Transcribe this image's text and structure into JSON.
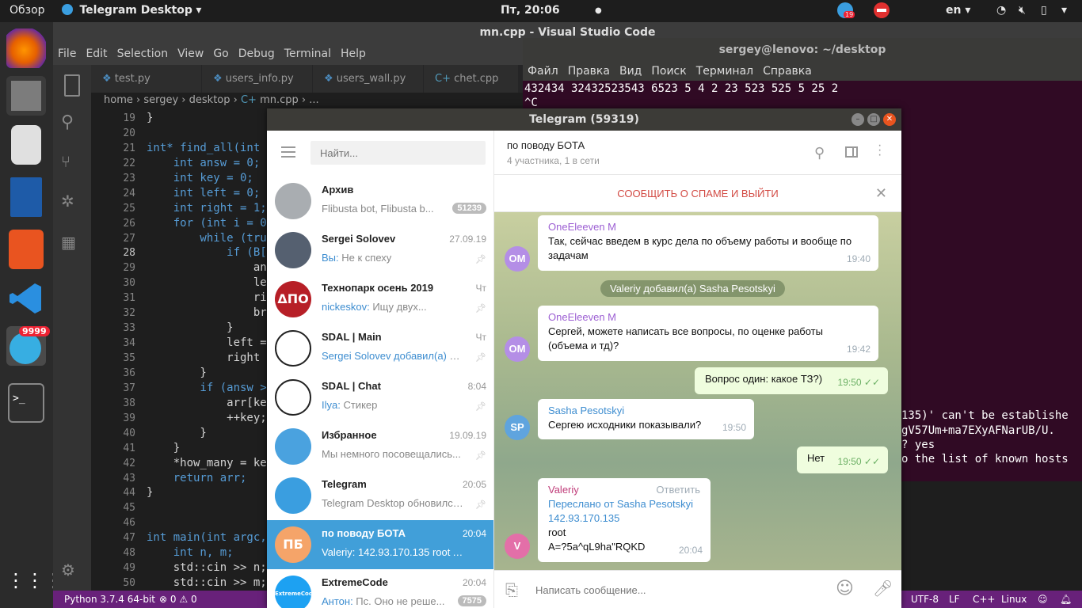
{
  "topbar": {
    "overview": "Обзор",
    "app_name": "Telegram Desktop",
    "clock": "Пт, 20:06",
    "lang": "en",
    "tray_badge": "19"
  },
  "dock": {
    "telegram_badge": "9999"
  },
  "vscode": {
    "title": "mn.cpp - Visual Studio Code",
    "menu": [
      "File",
      "Edit",
      "Selection",
      "View",
      "Go",
      "Debug",
      "Terminal",
      "Help"
    ],
    "tabs": [
      "test.py",
      "users_info.py",
      "users_wall.py",
      "chet.cpp"
    ],
    "breadcrumb": [
      "home",
      "sergey",
      "desktop",
      "mn.cpp",
      "..."
    ],
    "gutter": [
      "19",
      "20",
      "21",
      "22",
      "23",
      "24",
      "25",
      "26",
      "27",
      "28",
      "29",
      "30",
      "31",
      "32",
      "33",
      "34",
      "35",
      "36",
      "37",
      "38",
      "39",
      "40",
      "41",
      "42",
      "43",
      "44",
      "45",
      "46",
      "47",
      "48",
      "49",
      "50"
    ],
    "code": [
      "}",
      "",
      "int* find_all(int",
      "    int answ = 0;",
      "    int key = 0;",
      "    int left = 0;",
      "    int right = 1;",
      "    for (int i = 0",
      "        while (tru",
      "            if (B[",
      "                an",
      "                le",
      "                ri",
      "                br",
      "            }",
      "            left =",
      "            right",
      "        }",
      "        if (answ >",
      "            arr[ke",
      "            ++key;",
      "        }",
      "    }",
      "    *how_many = ke",
      "    return arr;",
      "}",
      "",
      "",
      "int main(int argc,",
      "    int n, m;",
      "    std::cin >> n;",
      "    std::cin >> m;"
    ],
    "status": {
      "python": "Python 3.7.4 64-bit",
      "errors": "0",
      "warnings": "0",
      "encoding": "UTF-8",
      "eol": "LF",
      "language": "C++",
      "os": "Linux"
    }
  },
  "terminal": {
    "title": "sergey@lenovo: ~/desktop",
    "menu": [
      "Файл",
      "Правка",
      "Вид",
      "Поиск",
      "Терминал",
      "Справка"
    ],
    "lines": [
      "432434 32432523543 6523 5 4 2 23 523 525 5 25 2",
      "^C"
    ],
    "lower_lines": [
      "135)' can't be establishe",
      "gV57Um+ma7EXyAFNarUB/U.",
      "? yes",
      "o the list of known hosts"
    ]
  },
  "telegram": {
    "title": "Telegram (59319)",
    "search_placeholder": "Найти...",
    "chats": [
      {
        "name": "Архив",
        "time": "",
        "sender": "",
        "preview": "Flibusta bot, Flibusta b...",
        "badge": "51239",
        "avatar": "",
        "color": "#a9adb1"
      },
      {
        "name": "Sergei Solovev",
        "time": "27.09.19",
        "sender": "Вы: ",
        "preview": "Не к спеху",
        "badge": "",
        "avatar": "",
        "color": "#556070"
      },
      {
        "name": "Технопарк осень 2019",
        "time": "Чт",
        "sender": "nickeskov: ",
        "preview": "Ищу двух...",
        "badge": "",
        "avatar": "ΔΠΟ",
        "color": "#b71f27"
      },
      {
        "name": "SDAL | Main",
        "time": "Чт",
        "sender": "",
        "preview": "Sergei Solovev добавил(а) S...",
        "badge": "",
        "avatar": "",
        "color": "#ffffff"
      },
      {
        "name": "SDAL | Chat",
        "time": "8:04",
        "sender": "Ilya: ",
        "preview": "Стикер",
        "badge": "",
        "avatar": "",
        "color": "#ffffff"
      },
      {
        "name": "Избранное",
        "time": "19.09.19",
        "sender": "",
        "preview": "Мы немного посовещались...",
        "badge": "",
        "avatar": "",
        "color": "#4aa2df"
      },
      {
        "name": "Telegram",
        "time": "20:05",
        "sender": "",
        "preview": "Telegram Desktop обновился д...",
        "badge": "",
        "avatar": "",
        "color": "#3a9ee0"
      },
      {
        "name": "по поводу БОТА",
        "time": "20:04",
        "sender": "",
        "preview": "Valeriy: 142.93.170.135 root A=?...",
        "badge": "",
        "avatar": "ПБ",
        "color": "#f5a469"
      },
      {
        "name": "ExtremeCode",
        "time": "20:04",
        "sender": "Антон: ",
        "preview": "Пс. Оно не реше...",
        "badge": "7575",
        "avatar": "ExtremeCode",
        "color": "#1da1f2"
      }
    ],
    "header": {
      "name": "по поводу БОТА",
      "status": "4 участника, 1 в сети"
    },
    "spam_bar": "СООБЩИТЬ О СПАМЕ И ВЫЙТИ",
    "messages": [
      {
        "sender": "OneEleeven M",
        "text1": "Так, сейчас введем в курс дела по объему работы и вообще по",
        "text2": "задачам",
        "time": "19:40",
        "avatar": "OM"
      },
      {
        "service": "Valeriy добавил(а) Sasha Pesotskyi"
      },
      {
        "sender": "OneEleeven M",
        "text1": "Сергей, можете написать все вопросы, по оценке работы",
        "text2": "(объема и тд)?",
        "time": "19:42",
        "avatar": "OM"
      },
      {
        "text1": "Вопрос один: какое ТЗ?)",
        "time": "19:50",
        "out": true
      },
      {
        "sender": "Sasha Pesotskyi",
        "text1": "Сергею исходники показывали?",
        "time": "19:50",
        "avatar": "SP"
      },
      {
        "text1": "Нет",
        "time": "19:50",
        "out": true
      },
      {
        "sender": "Valeriy",
        "reply": "Ответить",
        "fwd": "Переслано от Sasha Pesotskyi",
        "link": "142.93.170.135",
        "text1": "root",
        "text2": "A=?5a^qL9ha\"RQKD",
        "time": "20:04",
        "avatar": "V"
      }
    ],
    "compose_placeholder": "Написать сообщение..."
  }
}
